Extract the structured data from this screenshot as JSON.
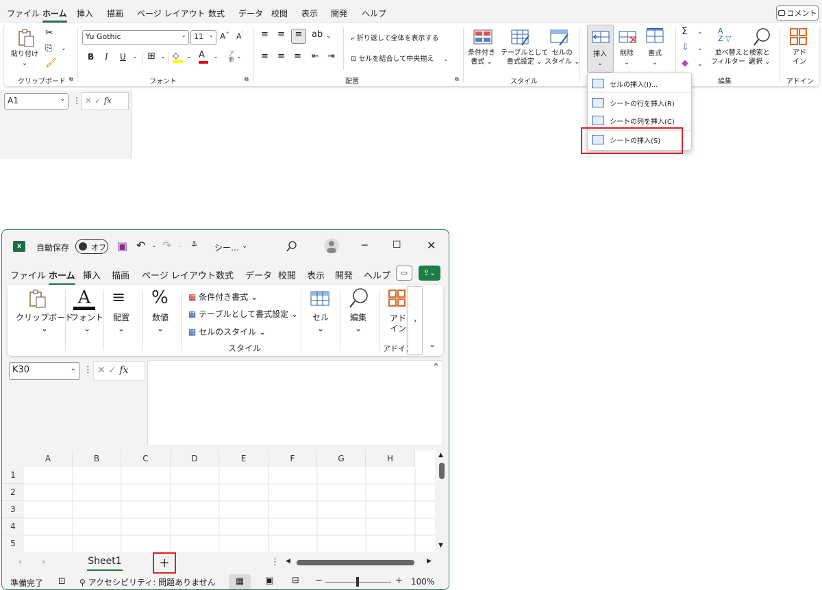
{
  "top": {
    "tabs": [
      "ファイル",
      "ホーム",
      "挿入",
      "描画",
      "ページ レイアウト",
      "数式",
      "データ",
      "校閲",
      "表示",
      "開発",
      "ヘルプ"
    ],
    "active_tab": "ホーム",
    "comment_button": "コメント",
    "clipboard": {
      "paste": "貼り付け",
      "group": "クリップボード"
    },
    "font": {
      "name": "Yu Gothic",
      "size": "11",
      "bold": "B",
      "italic": "I",
      "underline": "U",
      "grow": "A",
      "shrink": "A",
      "color_a": "A",
      "group": "フォント"
    },
    "alignment": {
      "wrap": "折り返して全体を表示する",
      "merge": "セルを結合して中央揃え",
      "group": "配置"
    },
    "styles": {
      "conditional_line1": "条件付き",
      "conditional_line2": "書式",
      "table_line1": "テーブルとして",
      "table_line2": "書式設定",
      "cell_line1": "セルの",
      "cell_line2": "スタイル",
      "group": "スタイル"
    },
    "cells": {
      "insert": "挿入",
      "delete": "削除",
      "format": "書式"
    },
    "editing": {
      "sort_line1": "並べ替えと",
      "sort_line2": "フィルター",
      "find_line1": "検索と",
      "find_line2": "選択",
      "group": "編集"
    },
    "addin": {
      "line1": "アド",
      "line2": "イン",
      "group": "アドイン"
    },
    "namebox": "A1",
    "fx": "fx",
    "insert_menu": [
      {
        "label": "セルの挿入(I)..."
      },
      {
        "label": "シートの行を挿入(R)"
      },
      {
        "label": "シートの列を挿入(C)"
      },
      {
        "label": "シートの挿入(S)"
      }
    ]
  },
  "window": {
    "autosave": "自動保存",
    "toggle": "オフ",
    "filename": "シー…",
    "tabs": [
      "ファイル",
      "ホーム",
      "挿入",
      "描画",
      "ページ レイアウト",
      "数式",
      "データ",
      "校閲",
      "表示",
      "開発",
      "ヘルプ"
    ],
    "active_tab": "ホーム",
    "ribbon": {
      "clipboard": "クリップボード",
      "font": "フォント",
      "alignment": "配置",
      "number": "数値",
      "conditional": "条件付き書式",
      "table": "テーブルとして書式設定",
      "cellstyle": "セルのスタイル",
      "styles_group": "スタイル",
      "cells": "セル",
      "editing": "編集",
      "addin_line1": "アド",
      "addin_line2": "イン",
      "addin_group": "アドイン"
    },
    "namebox": "K30",
    "fx": "fx",
    "columns": [
      "A",
      "B",
      "C",
      "D",
      "E",
      "F",
      "G",
      "H"
    ],
    "rows": [
      "1",
      "2",
      "3",
      "4",
      "5"
    ],
    "sheet_tab": "Sheet1",
    "add_sheet": "+",
    "status": {
      "ready": "準備完了",
      "accessibility": "アクセシビリティ: 問題ありません",
      "zoom": "100%"
    }
  }
}
